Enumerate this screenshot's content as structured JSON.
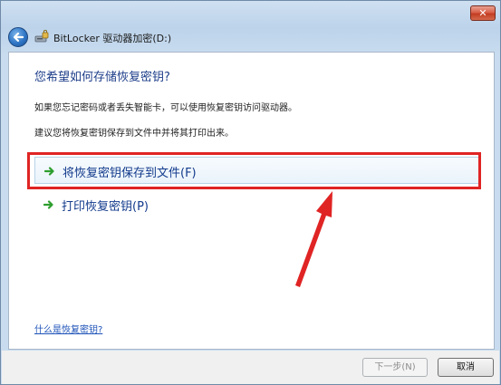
{
  "window": {
    "title": "BitLocker 驱动器加密(D:)",
    "close_glyph": "✕",
    "app_icon": "bitlocker-drive-icon"
  },
  "content": {
    "main_instruction": "您希望如何存储恢复密钥?",
    "descriptions": [
      "如果您忘记密码或者丢失智能卡，可以使用恢复密钥访问驱动器。",
      "建议您将恢复密钥保存到文件中并将其打印出来。"
    ],
    "options": [
      {
        "label": "将恢复密钥保存到文件(F)",
        "icon": "green-arrow-icon"
      },
      {
        "label": "打印恢复密钥(P)",
        "icon": "green-arrow-icon"
      }
    ],
    "help_link": "什么是恢复密钥?"
  },
  "footer": {
    "next_label": "下一步(N)",
    "next_enabled": false,
    "cancel_label": "取消"
  },
  "annotation": {
    "color": "#e02424"
  },
  "colors": {
    "instruction": "#1e3e8a",
    "link": "#1d52b8",
    "arrow_green": "#2e9e2e"
  }
}
